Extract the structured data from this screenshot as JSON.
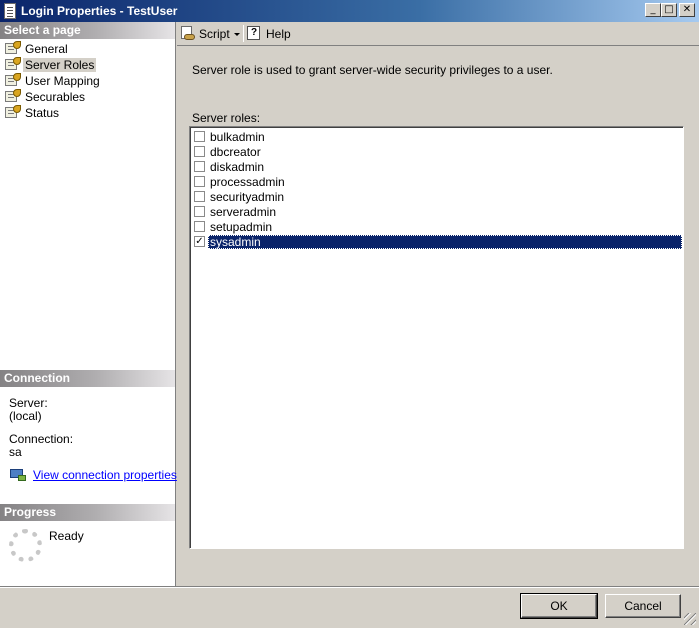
{
  "window": {
    "title": "Login Properties - TestUser",
    "controls": {
      "minimize": "_",
      "maximize": "□",
      "close": "✕"
    }
  },
  "left_panel": {
    "select_page_header": "Select a page",
    "pages": [
      {
        "label": "General",
        "icon": "page-settings-icon",
        "selected": false
      },
      {
        "label": "Server Roles",
        "icon": "page-settings-icon",
        "selected": true
      },
      {
        "label": "User Mapping",
        "icon": "page-settings-icon",
        "selected": false
      },
      {
        "label": "Securables",
        "icon": "page-settings-icon",
        "selected": false
      },
      {
        "label": "Status",
        "icon": "page-settings-icon",
        "selected": false
      }
    ],
    "connection": {
      "header": "Connection",
      "server_label": "Server:",
      "server_value": "(local)",
      "connection_label": "Connection:",
      "connection_value": "sa",
      "link_text": "View connection properties",
      "link_icon": "connection-properties-icon"
    },
    "progress": {
      "header": "Progress",
      "status": "Ready",
      "icon": "spinner-icon"
    }
  },
  "toolbar": {
    "script_label": "Script",
    "script_icon": "script-icon",
    "help_label": "Help",
    "help_icon": "help-icon"
  },
  "main": {
    "description": "Server role is used to grant server-wide security privileges to a user.",
    "roles_label": "Server roles:",
    "roles": [
      {
        "name": "bulkadmin",
        "checked": false
      },
      {
        "name": "dbcreator",
        "checked": false
      },
      {
        "name": "diskadmin",
        "checked": false
      },
      {
        "name": "processadmin",
        "checked": false
      },
      {
        "name": "securityadmin",
        "checked": false
      },
      {
        "name": "serveradmin",
        "checked": false
      },
      {
        "name": "setupadmin",
        "checked": false
      },
      {
        "name": "sysadmin",
        "checked": true,
        "selected": true
      }
    ]
  },
  "buttons": {
    "ok": "OK",
    "cancel": "Cancel"
  },
  "colors": {
    "selection": "#0a246a",
    "dialog_bg": "#d4d0c8",
    "link": "#0000ff"
  }
}
